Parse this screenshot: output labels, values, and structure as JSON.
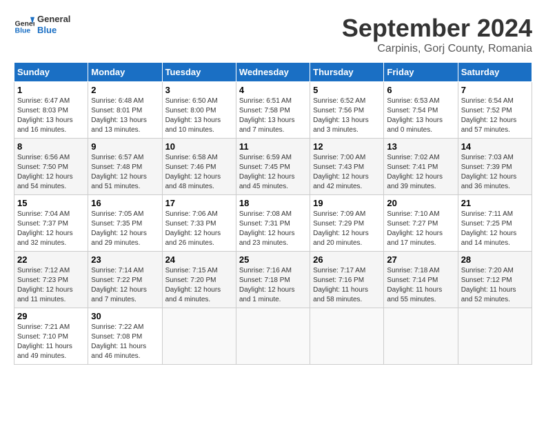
{
  "header": {
    "logo": {
      "line1": "General",
      "line2": "Blue"
    },
    "title": "September 2024",
    "subtitle": "Carpinis, Gorj County, Romania"
  },
  "weekdays": [
    "Sunday",
    "Monday",
    "Tuesday",
    "Wednesday",
    "Thursday",
    "Friday",
    "Saturday"
  ],
  "weeks": [
    [
      {
        "day": "1",
        "info": "Sunrise: 6:47 AM\nSunset: 8:03 PM\nDaylight: 13 hours\nand 16 minutes."
      },
      {
        "day": "2",
        "info": "Sunrise: 6:48 AM\nSunset: 8:01 PM\nDaylight: 13 hours\nand 13 minutes."
      },
      {
        "day": "3",
        "info": "Sunrise: 6:50 AM\nSunset: 8:00 PM\nDaylight: 13 hours\nand 10 minutes."
      },
      {
        "day": "4",
        "info": "Sunrise: 6:51 AM\nSunset: 7:58 PM\nDaylight: 13 hours\nand 7 minutes."
      },
      {
        "day": "5",
        "info": "Sunrise: 6:52 AM\nSunset: 7:56 PM\nDaylight: 13 hours\nand 3 minutes."
      },
      {
        "day": "6",
        "info": "Sunrise: 6:53 AM\nSunset: 7:54 PM\nDaylight: 13 hours\nand 0 minutes."
      },
      {
        "day": "7",
        "info": "Sunrise: 6:54 AM\nSunset: 7:52 PM\nDaylight: 12 hours\nand 57 minutes."
      }
    ],
    [
      {
        "day": "8",
        "info": "Sunrise: 6:56 AM\nSunset: 7:50 PM\nDaylight: 12 hours\nand 54 minutes."
      },
      {
        "day": "9",
        "info": "Sunrise: 6:57 AM\nSunset: 7:48 PM\nDaylight: 12 hours\nand 51 minutes."
      },
      {
        "day": "10",
        "info": "Sunrise: 6:58 AM\nSunset: 7:46 PM\nDaylight: 12 hours\nand 48 minutes."
      },
      {
        "day": "11",
        "info": "Sunrise: 6:59 AM\nSunset: 7:45 PM\nDaylight: 12 hours\nand 45 minutes."
      },
      {
        "day": "12",
        "info": "Sunrise: 7:00 AM\nSunset: 7:43 PM\nDaylight: 12 hours\nand 42 minutes."
      },
      {
        "day": "13",
        "info": "Sunrise: 7:02 AM\nSunset: 7:41 PM\nDaylight: 12 hours\nand 39 minutes."
      },
      {
        "day": "14",
        "info": "Sunrise: 7:03 AM\nSunset: 7:39 PM\nDaylight: 12 hours\nand 36 minutes."
      }
    ],
    [
      {
        "day": "15",
        "info": "Sunrise: 7:04 AM\nSunset: 7:37 PM\nDaylight: 12 hours\nand 32 minutes."
      },
      {
        "day": "16",
        "info": "Sunrise: 7:05 AM\nSunset: 7:35 PM\nDaylight: 12 hours\nand 29 minutes."
      },
      {
        "day": "17",
        "info": "Sunrise: 7:06 AM\nSunset: 7:33 PM\nDaylight: 12 hours\nand 26 minutes."
      },
      {
        "day": "18",
        "info": "Sunrise: 7:08 AM\nSunset: 7:31 PM\nDaylight: 12 hours\nand 23 minutes."
      },
      {
        "day": "19",
        "info": "Sunrise: 7:09 AM\nSunset: 7:29 PM\nDaylight: 12 hours\nand 20 minutes."
      },
      {
        "day": "20",
        "info": "Sunrise: 7:10 AM\nSunset: 7:27 PM\nDaylight: 12 hours\nand 17 minutes."
      },
      {
        "day": "21",
        "info": "Sunrise: 7:11 AM\nSunset: 7:25 PM\nDaylight: 12 hours\nand 14 minutes."
      }
    ],
    [
      {
        "day": "22",
        "info": "Sunrise: 7:12 AM\nSunset: 7:23 PM\nDaylight: 12 hours\nand 11 minutes."
      },
      {
        "day": "23",
        "info": "Sunrise: 7:14 AM\nSunset: 7:22 PM\nDaylight: 12 hours\nand 7 minutes."
      },
      {
        "day": "24",
        "info": "Sunrise: 7:15 AM\nSunset: 7:20 PM\nDaylight: 12 hours\nand 4 minutes."
      },
      {
        "day": "25",
        "info": "Sunrise: 7:16 AM\nSunset: 7:18 PM\nDaylight: 12 hours\nand 1 minute."
      },
      {
        "day": "26",
        "info": "Sunrise: 7:17 AM\nSunset: 7:16 PM\nDaylight: 11 hours\nand 58 minutes."
      },
      {
        "day": "27",
        "info": "Sunrise: 7:18 AM\nSunset: 7:14 PM\nDaylight: 11 hours\nand 55 minutes."
      },
      {
        "day": "28",
        "info": "Sunrise: 7:20 AM\nSunset: 7:12 PM\nDaylight: 11 hours\nand 52 minutes."
      }
    ],
    [
      {
        "day": "29",
        "info": "Sunrise: 7:21 AM\nSunset: 7:10 PM\nDaylight: 11 hours\nand 49 minutes."
      },
      {
        "day": "30",
        "info": "Sunrise: 7:22 AM\nSunset: 7:08 PM\nDaylight: 11 hours\nand 46 minutes."
      },
      {
        "day": "",
        "info": ""
      },
      {
        "day": "",
        "info": ""
      },
      {
        "day": "",
        "info": ""
      },
      {
        "day": "",
        "info": ""
      },
      {
        "day": "",
        "info": ""
      }
    ]
  ]
}
